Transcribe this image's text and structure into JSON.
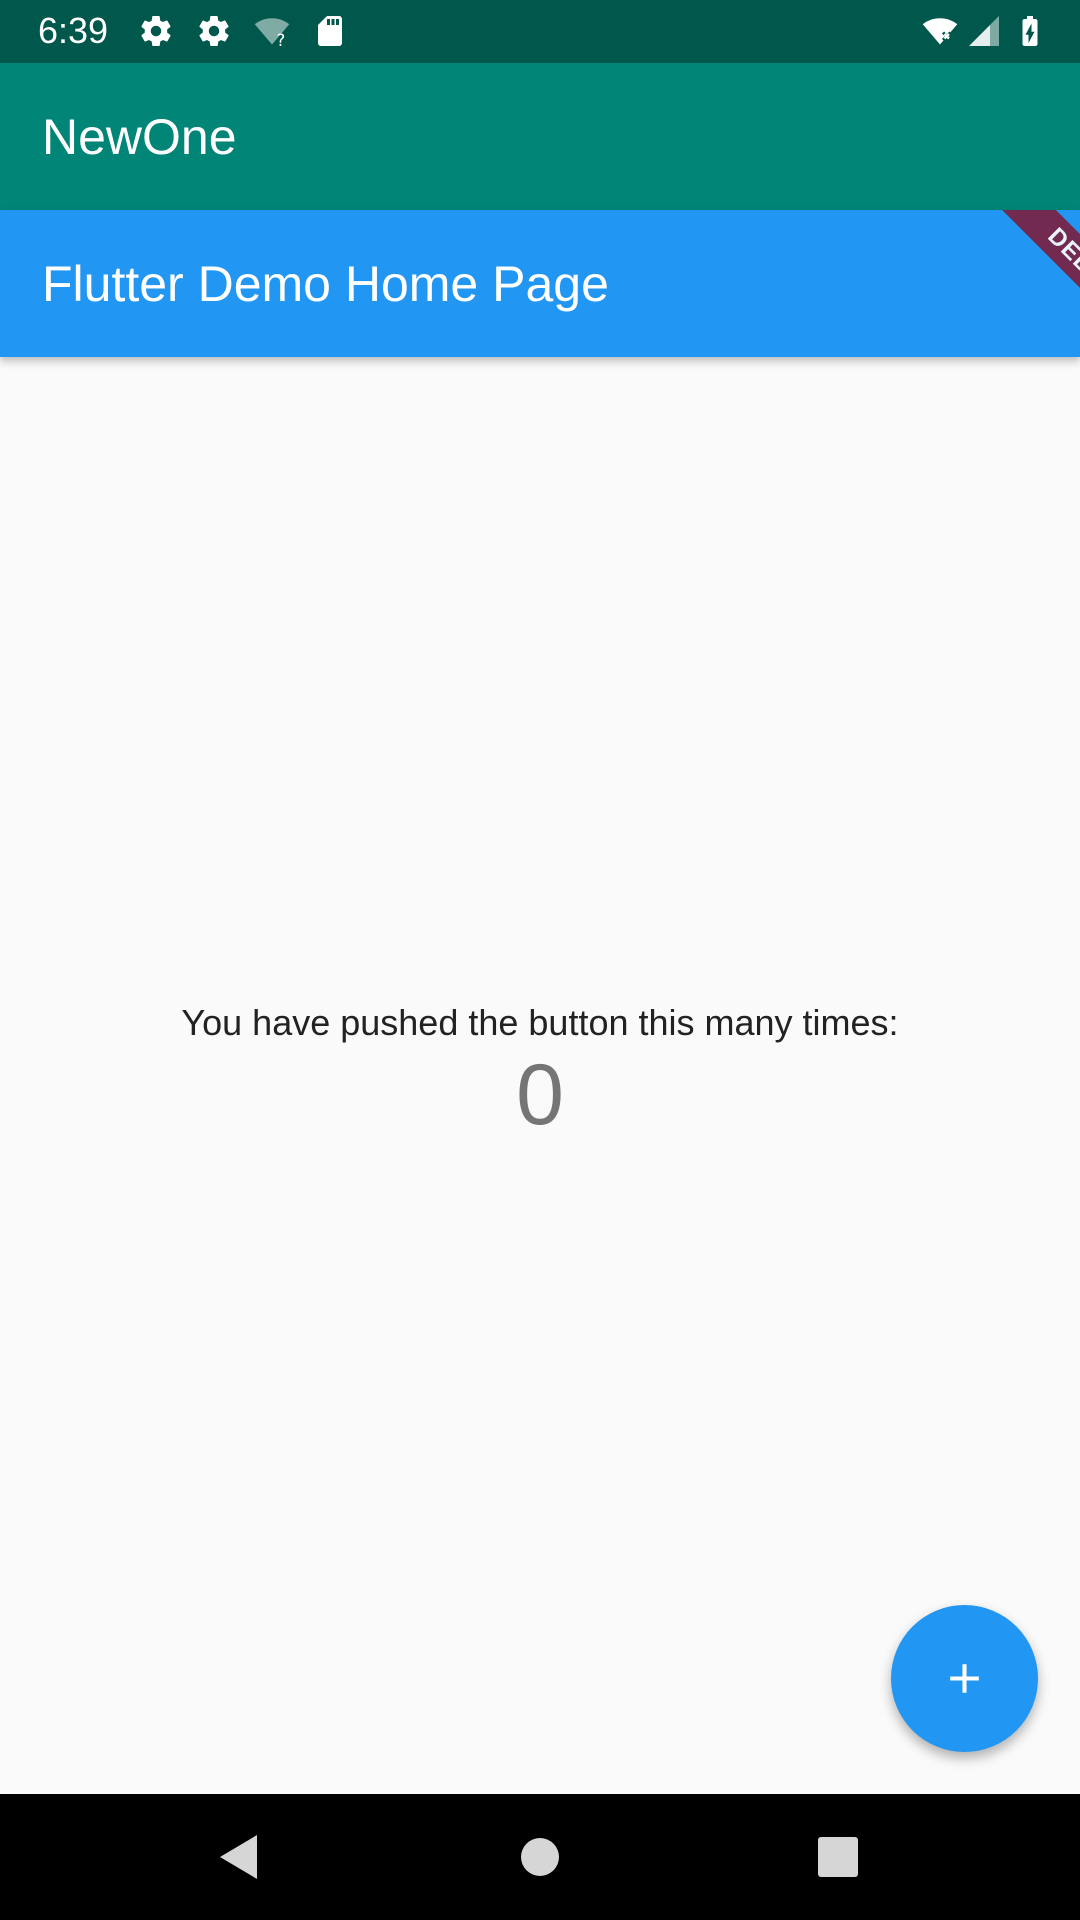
{
  "status_bar": {
    "time": "6:39",
    "left_icons": [
      "settings-icon",
      "settings-icon",
      "wifi-unknown-icon",
      "sd-card-icon"
    ],
    "right_icons": [
      "wifi-off-icon",
      "cell-signal-icon",
      "battery-charging-icon"
    ],
    "background": "#00574b"
  },
  "app_bar": {
    "title": "NewOne",
    "background": "#008577"
  },
  "page_bar": {
    "title": "Flutter Demo Home Page",
    "background": "#2196f3"
  },
  "debug_banner": {
    "label": "DEBUG",
    "color": "#7b1f3f"
  },
  "body": {
    "counter_label": "You have pushed the button this many times:",
    "counter_value": "0"
  },
  "fab": {
    "icon": "plus-icon",
    "color": "#2196f3"
  },
  "nav_bar": {
    "buttons": [
      "back-icon",
      "home-icon",
      "recents-icon"
    ]
  }
}
